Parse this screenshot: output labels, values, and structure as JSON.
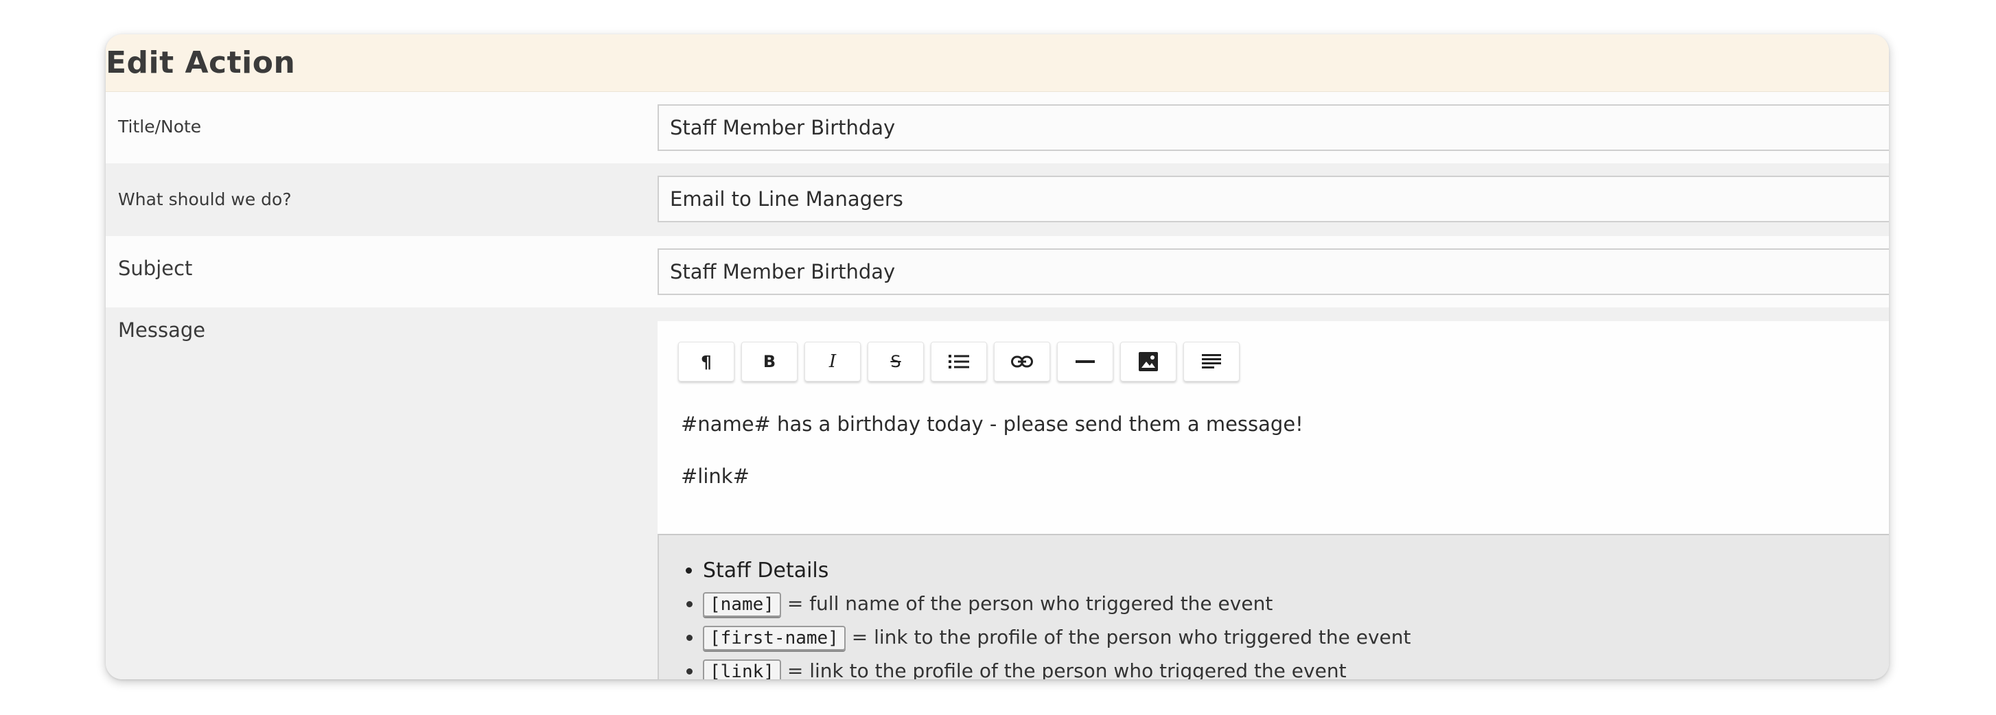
{
  "header": {
    "title": "Edit Action"
  },
  "fields": {
    "title_note": {
      "label": "Title/Note",
      "value": "Staff Member Birthday"
    },
    "action": {
      "label": "What should we do?",
      "value": "Email to Line Managers"
    },
    "subject": {
      "label": "Subject",
      "value": "Staff Member Birthday"
    },
    "message": {
      "label": "Message"
    }
  },
  "toolbar": {
    "buttons": [
      {
        "icon": "paragraph-icon",
        "glyph": "¶"
      },
      {
        "icon": "bold-icon",
        "glyph": "B"
      },
      {
        "icon": "italic-icon",
        "glyph": "I"
      },
      {
        "icon": "strikethrough-icon",
        "glyph": "S"
      },
      {
        "icon": "bullet-list-icon"
      },
      {
        "icon": "link-icon"
      },
      {
        "icon": "horizontal-rule-icon"
      },
      {
        "icon": "image-icon"
      },
      {
        "icon": "align-left-icon"
      }
    ]
  },
  "editor": {
    "line1": "#name# has a birthday today - please send them a message!",
    "line2": "#link#"
  },
  "help": {
    "heading": "Staff Details",
    "items": [
      {
        "code": "[name]",
        "text": "= full name of the person who triggered the event"
      },
      {
        "code": "[first-name]",
        "text": "= link to the profile of the person who triggered the event"
      },
      {
        "code": "[link]",
        "text": "= link to the profile of the person who triggered the event"
      }
    ]
  }
}
